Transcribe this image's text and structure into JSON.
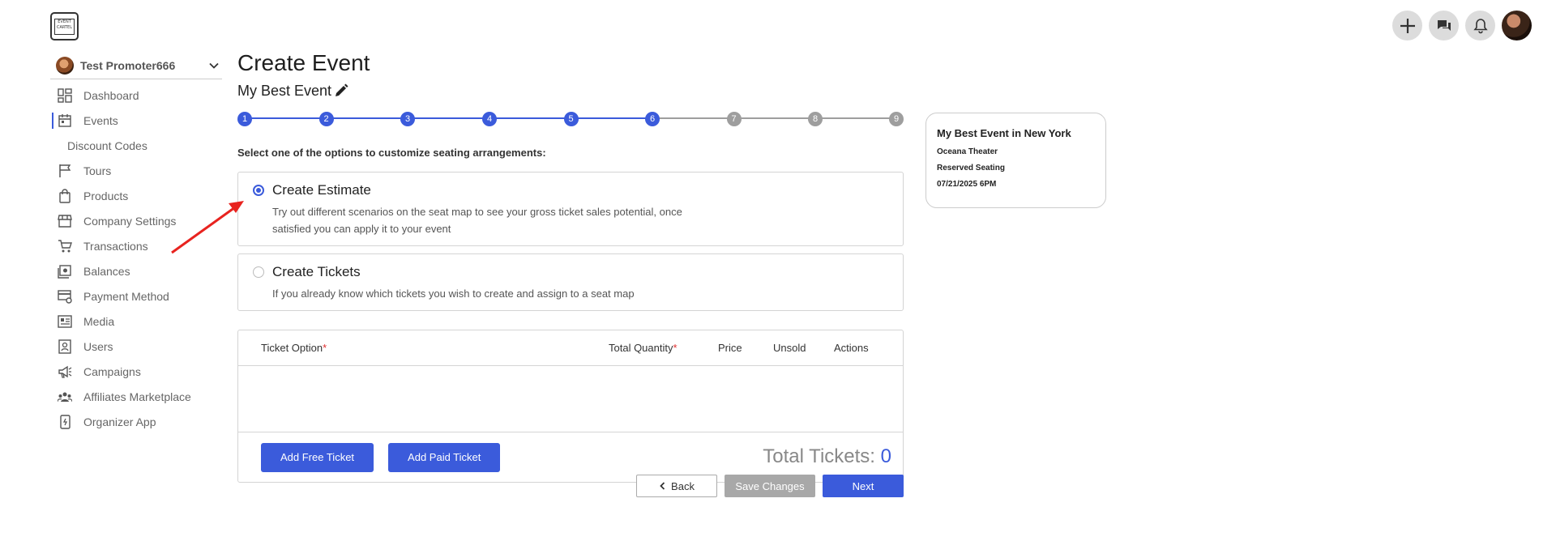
{
  "app": {
    "logo_text": "EVENT CARTEL",
    "top_actions": [
      {
        "name": "plus-icon"
      },
      {
        "name": "chat-icon"
      },
      {
        "name": "bell-icon"
      }
    ]
  },
  "sidebar": {
    "promoter": "Test Promoter666",
    "items": [
      {
        "label": "Dashboard",
        "icon": "dashboard-icon"
      },
      {
        "label": "Events",
        "icon": "calendar-icon",
        "active": true
      },
      {
        "label": "Discount Codes",
        "sub": true
      },
      {
        "label": "Tours",
        "icon": "flag-icon"
      },
      {
        "label": "Products",
        "icon": "bag-icon"
      },
      {
        "label": "Company Settings",
        "icon": "store-icon"
      },
      {
        "label": "Transactions",
        "icon": "cart-icon"
      },
      {
        "label": "Balances",
        "icon": "wallet-icon"
      },
      {
        "label": "Payment Method",
        "icon": "card-settings-icon"
      },
      {
        "label": "Media",
        "icon": "media-icon"
      },
      {
        "label": "Users",
        "icon": "user-badge-icon"
      },
      {
        "label": "Campaigns",
        "icon": "megaphone-icon"
      },
      {
        "label": "Affiliates Marketplace",
        "icon": "group-icon"
      },
      {
        "label": "Organizer App",
        "icon": "phone-icon"
      }
    ]
  },
  "main": {
    "title": "Create Event",
    "event_name": "My Best Event",
    "steps": [
      "1",
      "2",
      "3",
      "4",
      "5",
      "6",
      "7",
      "8",
      "9"
    ],
    "current_step": 6,
    "prompt": "Select one of the options to customize seating arrangements:",
    "options": [
      {
        "title": "Create Estimate",
        "desc": "Try out different scenarios on the seat map to see your gross ticket sales potential, once satisfied you can apply it to your event",
        "selected": true
      },
      {
        "title": "Create Tickets",
        "desc": "If you already know which tickets you wish to create and assign to a seat map",
        "selected": false
      }
    ],
    "table": {
      "headers": {
        "ticket_option": "Ticket Option",
        "total_quantity": "Total Quantity",
        "price": "Price",
        "unsold": "Unsold",
        "actions": "Actions"
      },
      "required_mark": "*",
      "add_free": "Add Free Ticket",
      "add_paid": "Add Paid Ticket",
      "total_label": "Total Tickets:",
      "total_value": "0"
    },
    "buttons": {
      "back": "Back",
      "save": "Save Changes",
      "next": "Next"
    }
  },
  "summary": {
    "title": "My Best Event in New York",
    "venue": "Oceana Theater",
    "seating": "Reserved Seating",
    "datetime": "07/21/2025 6PM"
  },
  "colors": {
    "accent": "#3b5bdb",
    "arrow": "#e8231f"
  }
}
